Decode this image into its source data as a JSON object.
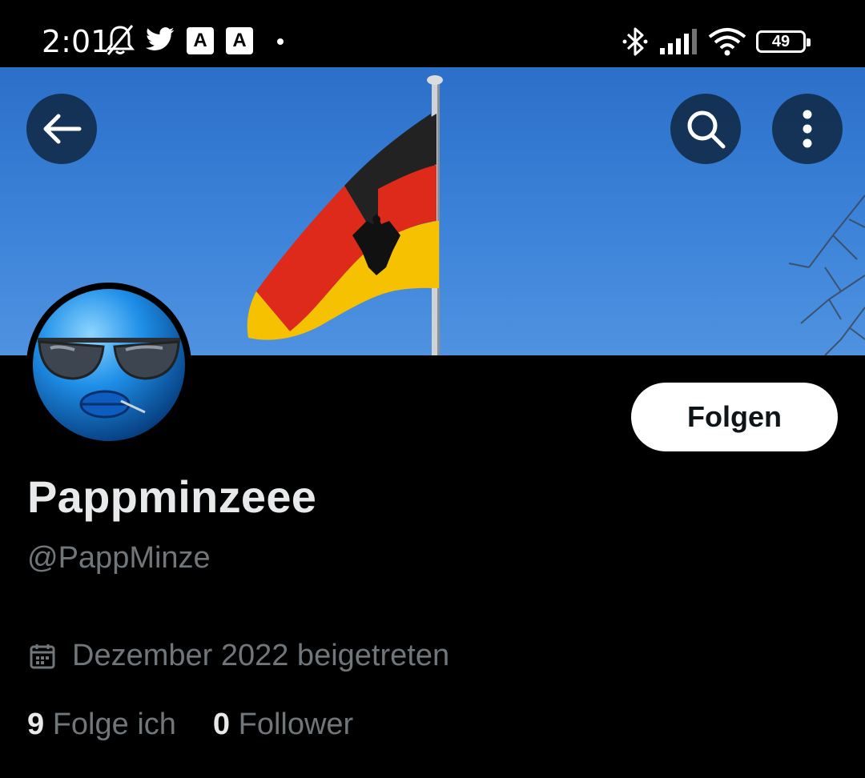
{
  "status_bar": {
    "time": "2:01",
    "app_icon_a1": "A",
    "app_icon_a2": "A",
    "battery_level": "49",
    "icons": [
      "bell-off-icon",
      "twitter-icon",
      "app-a-icon",
      "app-a-icon",
      "bluetooth-icon",
      "signal-icon",
      "wifi-icon",
      "battery-icon"
    ]
  },
  "header": {
    "icons": [
      "back-arrow-icon",
      "search-icon",
      "more-vertical-icon"
    ]
  },
  "profile": {
    "follow_label": "Folgen",
    "display_name": "Pappminzeee",
    "handle": "@PappMinze",
    "joined": "Dezember 2022 beigetreten",
    "following_count": "9",
    "following_label": "Folge ich",
    "followers_count": "0",
    "followers_label": "Follower"
  },
  "colors": {
    "background": "#000000",
    "primary_text": "#e7e9ea",
    "secondary_text": "#71767b",
    "button_bg": "#ffffff"
  }
}
